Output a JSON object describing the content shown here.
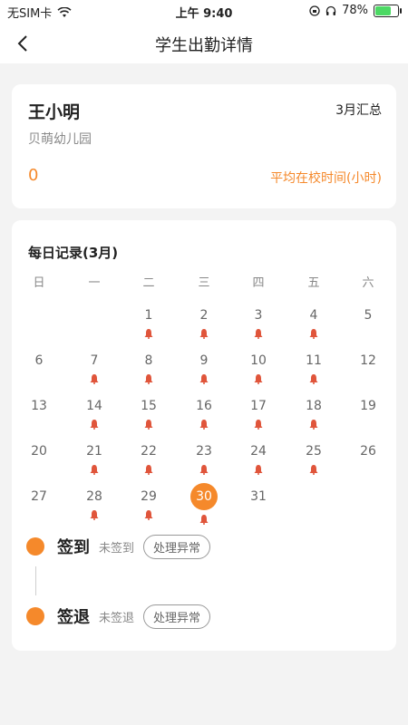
{
  "status_bar": {
    "carrier": "无SIM卡",
    "time": "上午 9:40",
    "battery": "78%",
    "battery_level": 0.78
  },
  "nav": {
    "title": "学生出勤详情"
  },
  "student": {
    "name": "王小明",
    "summary": "3月汇总",
    "school": "贝萌幼儿园",
    "value": "0",
    "metric_label": "平均在校时间(小时)"
  },
  "calendar": {
    "title": "每日记录(3月)",
    "weekdays": [
      "日",
      "一",
      "二",
      "三",
      "四",
      "五",
      "六"
    ],
    "weeks": [
      [
        null,
        null,
        {
          "n": "1",
          "m": true
        },
        {
          "n": "2",
          "m": true
        },
        {
          "n": "3",
          "m": true
        },
        {
          "n": "4",
          "m": true
        },
        {
          "n": "5",
          "m": false
        }
      ],
      [
        {
          "n": "6",
          "m": false
        },
        {
          "n": "7",
          "m": true
        },
        {
          "n": "8",
          "m": true
        },
        {
          "n": "9",
          "m": true
        },
        {
          "n": "10",
          "m": true
        },
        {
          "n": "11",
          "m": true
        },
        {
          "n": "12",
          "m": false
        }
      ],
      [
        {
          "n": "13",
          "m": false
        },
        {
          "n": "14",
          "m": true
        },
        {
          "n": "15",
          "m": true
        },
        {
          "n": "16",
          "m": true
        },
        {
          "n": "17",
          "m": true
        },
        {
          "n": "18",
          "m": true
        },
        {
          "n": "19",
          "m": false
        }
      ],
      [
        {
          "n": "20",
          "m": false
        },
        {
          "n": "21",
          "m": true
        },
        {
          "n": "22",
          "m": true
        },
        {
          "n": "23",
          "m": true
        },
        {
          "n": "24",
          "m": true
        },
        {
          "n": "25",
          "m": true
        },
        {
          "n": "26",
          "m": false
        }
      ],
      [
        {
          "n": "27",
          "m": false
        },
        {
          "n": "28",
          "m": true
        },
        {
          "n": "29",
          "m": true
        },
        {
          "n": "30",
          "m": true,
          "today": true
        },
        {
          "n": "31",
          "m": false
        },
        null,
        null
      ]
    ],
    "accent": "#f5892b",
    "mark_color": "#e0553b"
  },
  "attendance": {
    "sign_in": {
      "label": "签到",
      "state": "未签到",
      "action": "处理异常"
    },
    "sign_out": {
      "label": "签退",
      "state": "未签退",
      "action": "处理异常"
    }
  }
}
